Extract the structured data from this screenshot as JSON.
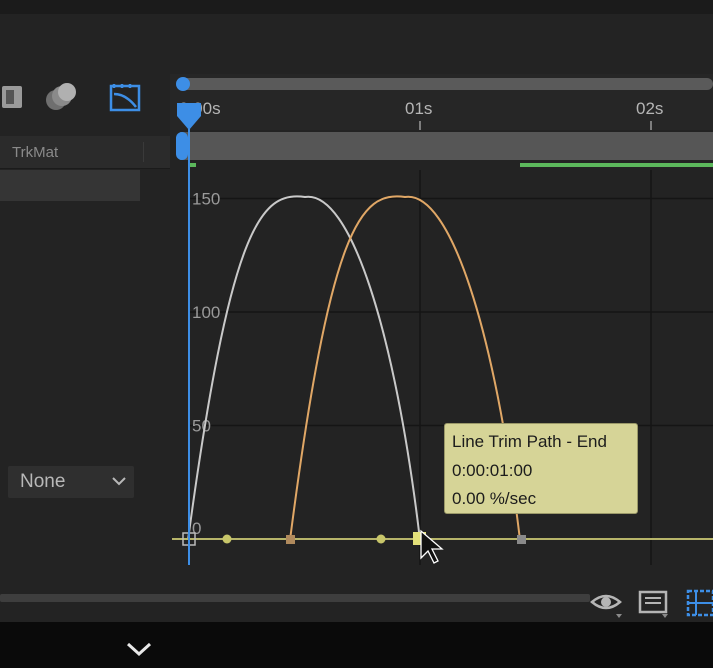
{
  "timeline": {
    "ruler_ticks": [
      {
        "label": "0:00s",
        "t": 0
      },
      {
        "label": "01s",
        "t": 1
      },
      {
        "label": "02s",
        "t": 2
      }
    ]
  },
  "left_panel": {
    "column_header": "TrkMat",
    "trkmat_value": "None"
  },
  "graph": {
    "y_ticks": [
      {
        "label": "150",
        "value": 150
      },
      {
        "label": "100",
        "value": 100
      },
      {
        "label": "50",
        "value": 50
      },
      {
        "label": "0",
        "value": 0
      }
    ],
    "colors": {
      "curve_white": "#c9c9c9",
      "curve_orange": "#e0a766",
      "keyframe_line": "#b7b56a",
      "work_area": "#5cb85c",
      "playhead": "#3d8ee6"
    },
    "tooltip": {
      "property": "Line Trim Path - End",
      "time": "0:00:01:00",
      "velocity": "0.00 %/sec"
    }
  },
  "icons": [
    "comp-icon",
    "motion-blur-icon",
    "graph-editor-icon",
    "eye-icon",
    "graph-type-icon",
    "snap-icon",
    "chevron-down-icon"
  ]
}
